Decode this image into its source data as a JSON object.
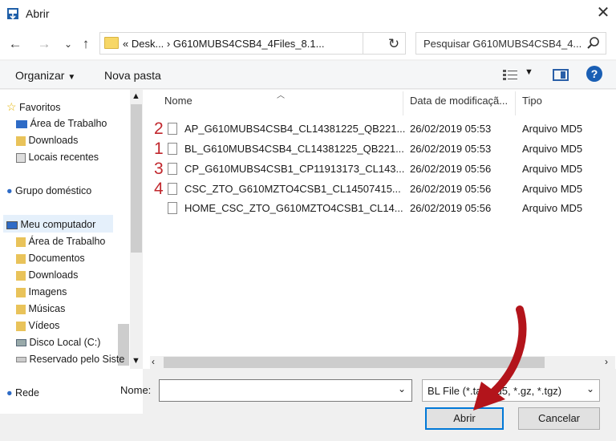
{
  "window": {
    "title": "Abrir",
    "close": "✕"
  },
  "address": {
    "path": "«  Desk...  ›  G610MUBS4CSB4_4Files_8.1...",
    "search_placeholder": "Pesquisar G610MUBS4CSB4_4..."
  },
  "toolbar": {
    "organize": "Organizar",
    "new_folder": "Nova pasta"
  },
  "nav": {
    "favorites": "Favoritos",
    "fav_items": [
      "Área de Trabalho",
      "Downloads",
      "Locais recentes"
    ],
    "homegroup": "Grupo doméstico",
    "computer": "Meu computador",
    "comp_items": [
      "Área de Trabalho",
      "Documentos",
      "Downloads",
      "Imagens",
      "Músicas",
      "Vídeos",
      "Disco Local (C:)",
      "Reservado pelo Siste"
    ],
    "network": "Rede"
  },
  "columns": {
    "name": "Nome",
    "date": "Data de modificaçã...",
    "type": "Tipo"
  },
  "files": [
    {
      "marker": "2",
      "name": "AP_G610MUBS4CSB4_CL14381225_QB221...",
      "date": "26/02/2019 05:53",
      "type": "Arquivo MD5"
    },
    {
      "marker": "1",
      "name": "BL_G610MUBS4CSB4_CL14381225_QB221...",
      "date": "26/02/2019 05:53",
      "type": "Arquivo MD5"
    },
    {
      "marker": "3",
      "name": "CP_G610MUBS4CSB1_CP11913173_CL143...",
      "date": "26/02/2019 05:56",
      "type": "Arquivo MD5"
    },
    {
      "marker": "4",
      "name": "CSC_ZTO_G610MZTO4CSB1_CL14507415...",
      "date": "26/02/2019 05:56",
      "type": "Arquivo MD5"
    },
    {
      "marker": "",
      "name": "HOME_CSC_ZTO_G610MZTO4CSB1_CL14...",
      "date": "26/02/2019 05:56",
      "type": "Arquivo MD5"
    }
  ],
  "bottom": {
    "name_label": "Nome:",
    "name_value": "",
    "filter": "BL File (*.tar.md5, *.gz, *.tgz)",
    "open": "Abrir",
    "cancel": "Cancelar"
  },
  "colors": {
    "annotation": "#c1272d",
    "accent": "#0078d7"
  }
}
